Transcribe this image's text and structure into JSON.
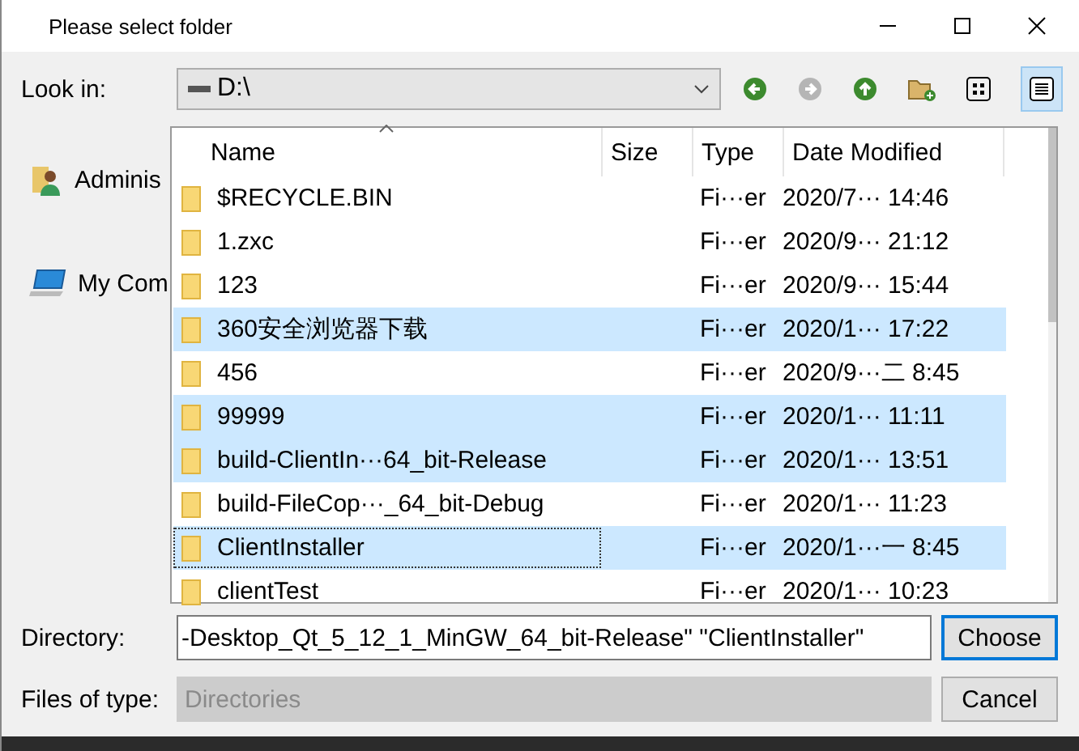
{
  "window": {
    "title": "Please select folder"
  },
  "look_in": {
    "label": "Look in:",
    "value": "D:\\"
  },
  "sidebar": {
    "items": [
      {
        "kind": "user",
        "label": "Adminis"
      },
      {
        "kind": "computer",
        "label": "My Com"
      }
    ]
  },
  "table": {
    "columns": [
      "Name",
      "Size",
      "Type",
      "Date Modified"
    ],
    "rows": [
      {
        "name": "$RECYCLE.BIN",
        "type": "Fi···er",
        "date": "2020/7··· 14:46",
        "selected": false,
        "focused": false
      },
      {
        "name": "1.zxc",
        "type": "Fi···er",
        "date": "2020/9··· 21:12",
        "selected": false,
        "focused": false
      },
      {
        "name": "123",
        "type": "Fi···er",
        "date": "2020/9··· 15:44",
        "selected": false,
        "focused": false
      },
      {
        "name": "360安全浏览器下载",
        "type": "Fi···er",
        "date": "2020/1··· 17:22",
        "selected": true,
        "focused": false
      },
      {
        "name": "456",
        "type": "Fi···er",
        "date": "2020/9···二 8:45",
        "selected": false,
        "focused": false
      },
      {
        "name": "99999",
        "type": "Fi···er",
        "date": "2020/1··· 11:11",
        "selected": true,
        "focused": false
      },
      {
        "name": "build-ClientIn···64_bit-Release",
        "type": "Fi···er",
        "date": "2020/1··· 13:51",
        "selected": true,
        "focused": false
      },
      {
        "name": "build-FileCop···_64_bit-Debug",
        "type": "Fi···er",
        "date": "2020/1··· 11:23",
        "selected": false,
        "focused": false
      },
      {
        "name": "ClientInstaller",
        "type": "Fi···er",
        "date": "2020/1···一 8:45",
        "selected": true,
        "focused": true
      },
      {
        "name": "clientTest",
        "type": "Fi···er",
        "date": "2020/1··· 10:23",
        "selected": false,
        "focused": false
      }
    ]
  },
  "directory": {
    "label": "Directory:",
    "value": "-Desktop_Qt_5_12_1_MinGW_64_bit-Release\" \"ClientInstaller\""
  },
  "files_of_type": {
    "label": "Files of type:",
    "value": "Directories",
    "disabled": true
  },
  "buttons": [
    {
      "label": "Choose",
      "default": true
    },
    {
      "label": "Cancel",
      "default": false
    }
  ]
}
